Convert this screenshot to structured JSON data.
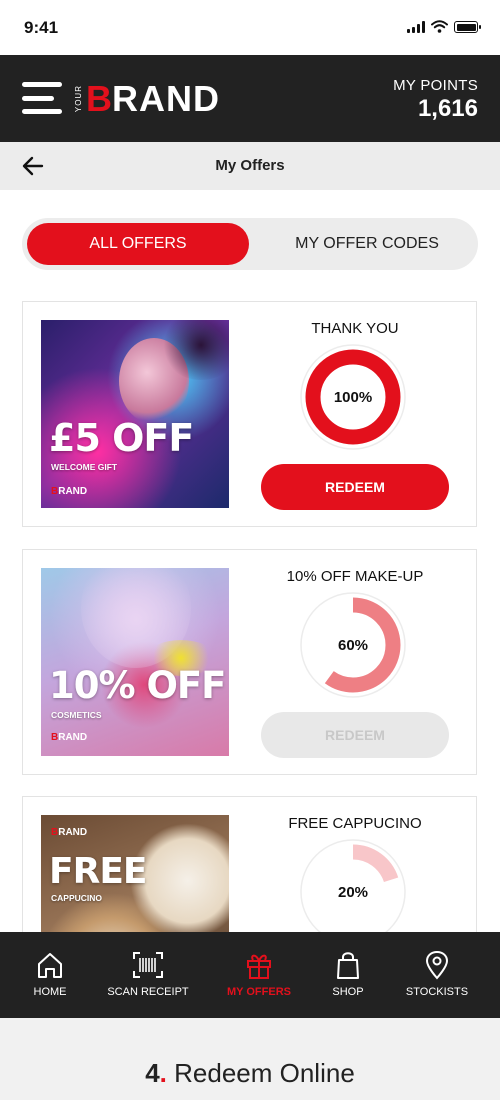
{
  "status_bar": {
    "time": "9:41",
    "icons": [
      "signal-icon",
      "wifi-icon",
      "battery-icon"
    ]
  },
  "header": {
    "brand_small": "YOUR",
    "brand_first": "B",
    "brand_rest": "RAND",
    "points_label": "MY POINTS",
    "points_value": "1,616"
  },
  "subheader": {
    "title": "My Offers",
    "back_icon": "arrow-left-icon"
  },
  "tabs": [
    {
      "label": "ALL OFFERS",
      "active": true
    },
    {
      "label": "MY OFFER CODES",
      "active": false
    }
  ],
  "offers": [
    {
      "title": "THANK YOU",
      "progress_percent": 100,
      "progress_label": "100%",
      "redeem_label": "REDEEM",
      "redeem_enabled": true,
      "image": {
        "headline": "£5 OFF",
        "subline": "WELCOME GIFT",
        "brand_first": "B",
        "brand_rest": "RAND"
      }
    },
    {
      "title": "10% OFF MAKE-UP",
      "progress_percent": 60,
      "progress_label": "60%",
      "redeem_label": "REDEEM",
      "redeem_enabled": false,
      "image": {
        "headline": "10% OFF",
        "subline": "COSMETICS",
        "brand_first": "B",
        "brand_rest": "RAND"
      }
    },
    {
      "title": "FREE CAPPUCINO",
      "progress_percent": 20,
      "progress_label": "20%",
      "image": {
        "headline": "FREE",
        "subline": "CAPPUCINO",
        "brand_first": "B",
        "brand_rest": "RAND"
      }
    }
  ],
  "colors": {
    "brand_red": "#e3101c",
    "ring_mid": "#ee7f84",
    "ring_light": "#f8c6c9",
    "dark": "#222222"
  },
  "bottom_nav": [
    {
      "label": "HOME",
      "icon": "home-icon",
      "active": false
    },
    {
      "label": "SCAN RECEIPT",
      "icon": "barcode-scan-icon",
      "active": false
    },
    {
      "label": "MY OFFERS",
      "icon": "gift-icon",
      "active": true
    },
    {
      "label": "SHOP",
      "icon": "shopping-bag-icon",
      "active": false
    },
    {
      "label": "STOCKISTS",
      "icon": "map-pin-icon",
      "active": false
    }
  ],
  "caption": {
    "number": "4",
    "dot": ".",
    "text": " Redeem Online"
  }
}
